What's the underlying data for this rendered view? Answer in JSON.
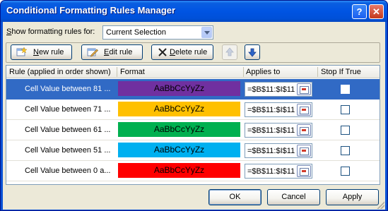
{
  "window": {
    "title": "Conditional Formatting Rules Manager",
    "help_glyph": "?",
    "close_glyph": "✕"
  },
  "scope": {
    "label_before": "S",
    "label_rest": "how formatting rules for:",
    "value": "Current Selection"
  },
  "toolbar": {
    "new_rule_accel": "N",
    "new_rule_rest": "ew rule",
    "edit_rule_accel": "E",
    "edit_rule_rest": "dit rule",
    "delete_rule_accel": "D",
    "delete_rule_rest": "elete rule",
    "move_up_glyph": "🡅",
    "move_down_glyph": "🡇"
  },
  "grid": {
    "columns": [
      "Rule (applied in order shown)",
      "Format",
      "Applies to",
      "Stop If True"
    ],
    "rows": [
      {
        "rule": "Cell Value between 81 ...",
        "format_preview": "AaBbCcYyZz",
        "color": "#7030a0",
        "applies_to": "=$B$11:$I$11",
        "stop_if_true": false,
        "selected": true
      },
      {
        "rule": "Cell Value between 71 ...",
        "format_preview": "AaBbCcYyZz",
        "color": "#ffc000",
        "applies_to": "=$B$11:$I$11",
        "stop_if_true": false,
        "selected": false
      },
      {
        "rule": "Cell Value between 61 ...",
        "format_preview": "AaBbCcYyZz",
        "color": "#00b050",
        "applies_to": "=$B$11:$I$11",
        "stop_if_true": false,
        "selected": false
      },
      {
        "rule": "Cell Value between 51 ...",
        "format_preview": "AaBbCcYyZz",
        "color": "#00b0f0",
        "applies_to": "=$B$11:$I$11",
        "stop_if_true": false,
        "selected": false
      },
      {
        "rule": "Cell Value between 0 a...",
        "format_preview": "AaBbCcYyZz",
        "color": "#ff0000",
        "applies_to": "=$B$11:$I$11",
        "stop_if_true": false,
        "selected": false
      }
    ]
  },
  "buttons": {
    "ok": "OK",
    "cancel": "Cancel",
    "apply": "Apply"
  },
  "colors": {
    "title_bar": "#0054e3",
    "dialog_face": "#ece9d8",
    "selection": "#316ac5"
  }
}
